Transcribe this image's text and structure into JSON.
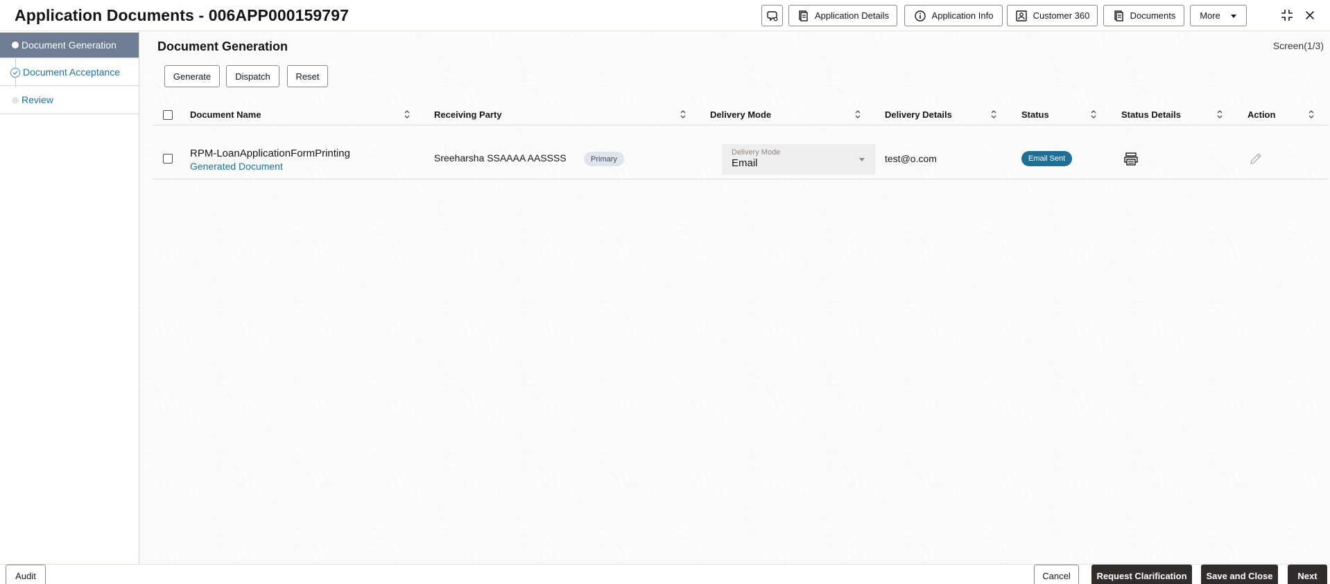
{
  "header": {
    "title": "Application Documents - 006APP000159797",
    "buttons": {
      "application_details": "Application Details",
      "application_info": "Application Info",
      "customer_360": "Customer 360",
      "documents": "Documents",
      "more": "More"
    }
  },
  "sidebar": {
    "steps": [
      {
        "label": "Document Generation",
        "state": "active"
      },
      {
        "label": "Document Acceptance",
        "state": "completed"
      },
      {
        "label": "Review",
        "state": "pending"
      }
    ]
  },
  "main": {
    "title": "Document Generation",
    "screen_count": "Screen(1/3)",
    "actions": {
      "generate": "Generate",
      "dispatch": "Dispatch",
      "reset": "Reset"
    },
    "table": {
      "columns": [
        "Document Name",
        "Receiving Party",
        "Delivery Mode",
        "Delivery Details",
        "Status",
        "Status Details",
        "Action"
      ],
      "rows": [
        {
          "document_name": "RPM-LoanApplicationFormPrinting",
          "document_link": "Generated Document",
          "receiving_party": "Sreeharsha SSAAAA AASSSS",
          "party_badge": "Primary",
          "delivery_mode_label": "Delivery Mode",
          "delivery_mode": "Email",
          "delivery_details": "test@o.com",
          "status": "Email Sent"
        }
      ]
    }
  },
  "footer": {
    "audit": "Audit",
    "cancel": "Cancel",
    "request_clarification": "Request Clarification",
    "save_and_close": "Save and Close",
    "next": "Next"
  },
  "colors": {
    "accent_link": "#227093",
    "sidebar_active": "#6e7d93",
    "status_pill": "#1d6f95",
    "primary_button": "#312d2a"
  }
}
